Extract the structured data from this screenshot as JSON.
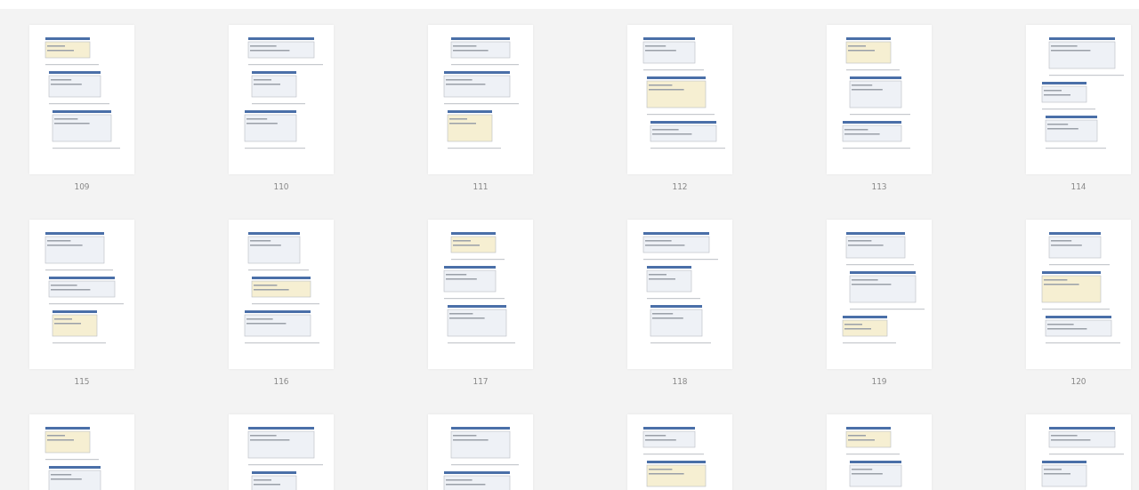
{
  "pages": [
    {
      "kind": "page",
      "number": "109"
    },
    {
      "kind": "page",
      "number": "110"
    },
    {
      "kind": "page",
      "number": "111"
    },
    {
      "kind": "page",
      "number": "112"
    },
    {
      "kind": "page",
      "number": "113"
    },
    {
      "kind": "page",
      "number": "114"
    },
    {
      "kind": "page",
      "number": "115"
    },
    {
      "kind": "page",
      "number": "116"
    },
    {
      "kind": "page",
      "number": "117"
    },
    {
      "kind": "page",
      "number": "118"
    },
    {
      "kind": "page",
      "number": "119"
    },
    {
      "kind": "page",
      "number": "120"
    },
    {
      "kind": "page"
    },
    {
      "kind": "page"
    },
    {
      "kind": "page"
    },
    {
      "kind": "page"
    },
    {
      "kind": "page"
    },
    {
      "kind": "page"
    }
  ]
}
